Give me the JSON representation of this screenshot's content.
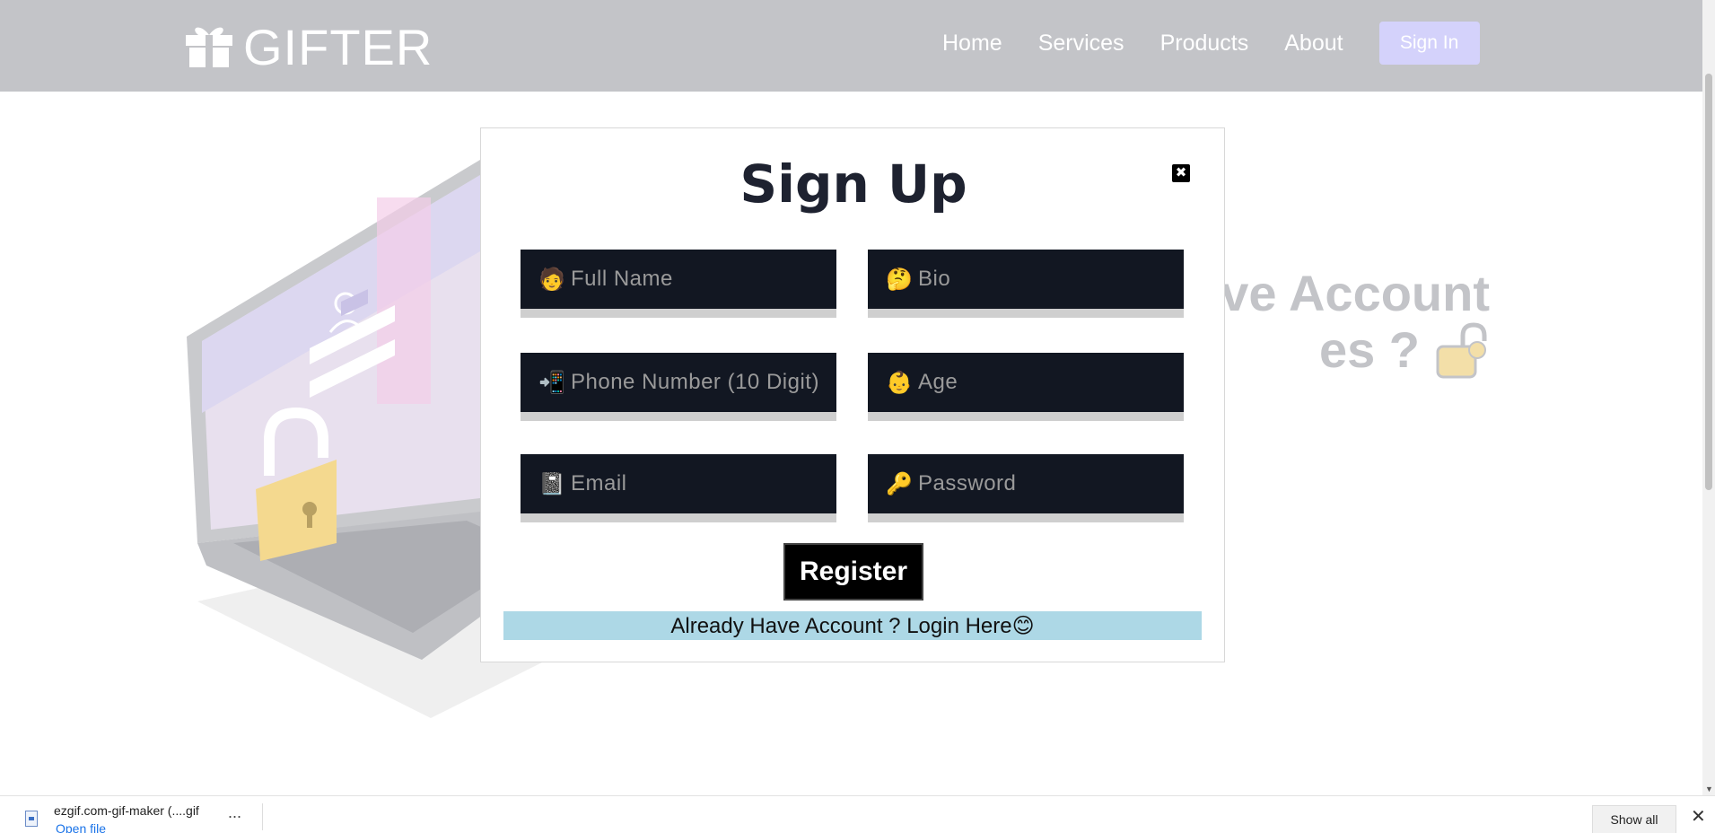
{
  "navbar": {
    "brand": "GIFTER",
    "brand_icon": "gift-icon",
    "links": [
      "Home",
      "Services",
      "Products",
      "About"
    ],
    "signin_label": "Sign In"
  },
  "hero": {
    "line1": "ve Account",
    "line2": "es ?"
  },
  "modal": {
    "title": "Sign Up",
    "close_icon": "close-icon",
    "fields": {
      "full_name": {
        "icon": "🧑",
        "placeholder": "Full Name"
      },
      "bio": {
        "icon": "🤔",
        "placeholder": "Bio"
      },
      "phone": {
        "icon": "📲",
        "placeholder": "Phone Number (10 Digit)"
      },
      "age": {
        "icon": "👶",
        "placeholder": "Age"
      },
      "email": {
        "icon": "📓",
        "placeholder": "Email"
      },
      "password": {
        "icon": "🔑",
        "placeholder": "Password"
      }
    },
    "register_label": "Register",
    "login_text": "Already Have Account ? Login Here😊"
  },
  "download_bar": {
    "file_name": "ezgif.com-gif-maker (....gif",
    "open_label": "Open file",
    "more_label": "...",
    "show_all_label": "Show all",
    "close_label": "✕"
  },
  "colors": {
    "navbar_bg": "#c3c4c8",
    "field_bg": "#121722",
    "login_bar_bg": "#add8e6",
    "signin_bg": "#d4d2fb"
  }
}
